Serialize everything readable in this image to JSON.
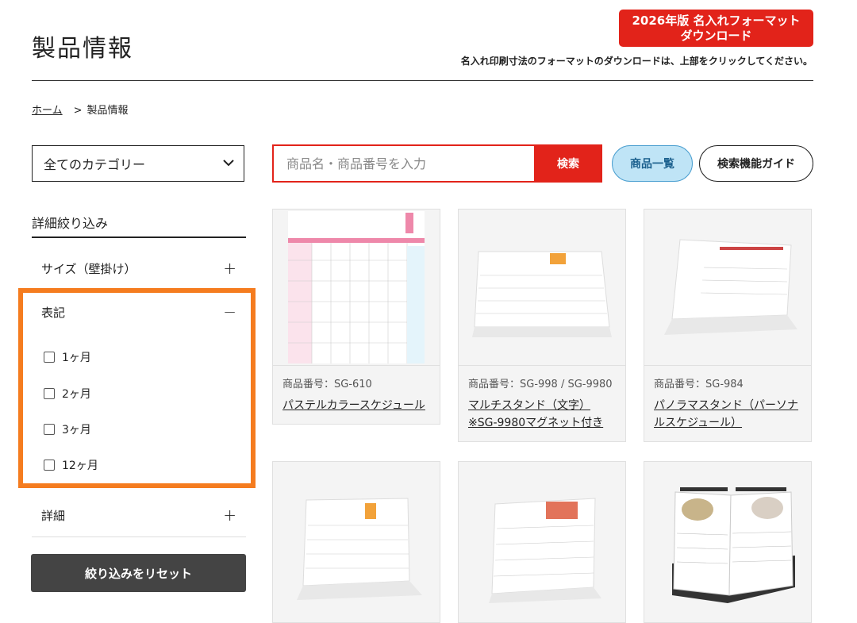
{
  "header": {
    "title": "製品情報",
    "download_line1": "2026年版 名入れフォーマット",
    "download_line2": "ダウンロード",
    "download_note": "名入れ印刷寸法のフォーマットのダウンロードは、上部をクリックしてください。"
  },
  "breadcrumb": {
    "home": "ホーム",
    "separator": ">",
    "current": "製品情報"
  },
  "category": {
    "selected": "全てのカテゴリー"
  },
  "search": {
    "placeholder": "商品名・商品番号を入力",
    "button": "検索"
  },
  "buttons": {
    "product_list": "商品一覧",
    "search_guide": "検索機能ガイド",
    "reset": "絞り込みをリセット"
  },
  "filters": {
    "heading": "詳細絞り込み",
    "size_label": "サイズ（壁掛け）",
    "notation_label": "表記",
    "detail_label": "詳細",
    "expand_sign": "+",
    "collapse_sign": "−",
    "notation_options": [
      "1ヶ月",
      "2ヶ月",
      "3ヶ月",
      "12ヶ月"
    ]
  },
  "products": [
    {
      "code": "商品番号：SG-610",
      "name": "パステルカラースケジュール",
      "name2": ""
    },
    {
      "code": "商品番号：SG-998 / SG-9980",
      "name": "マルチスタンド（文字）",
      "name2": "※SG-9980マグネット付き"
    },
    {
      "code": "商品番号：SG-984",
      "name": "パノラマスタンド（パーソナ",
      "name2": "ルスケジュール）"
    }
  ],
  "colors": {
    "brand_red": "#e2231a",
    "highlight_orange": "#f57c1f",
    "pill_blue": "#bfe4f6"
  }
}
